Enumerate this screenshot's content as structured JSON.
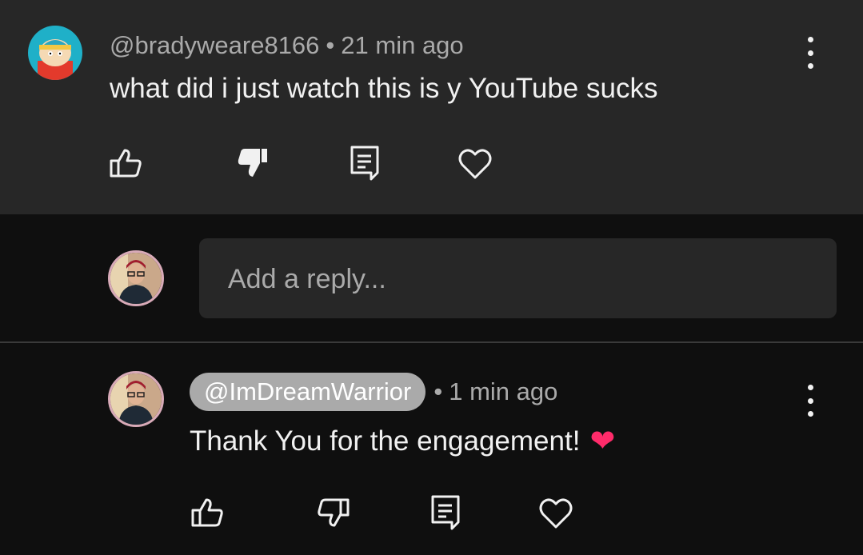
{
  "top_comment": {
    "author": "@bradyweare8166",
    "separator": "•",
    "time": "21 min ago",
    "text": "what did i just watch this is y YouTube sucks",
    "avatar_icon": "cartman-avatar-icon",
    "like_state": "none",
    "dislike_state": "active"
  },
  "reply_input": {
    "placeholder": "Add a reply..."
  },
  "reply_comment": {
    "author": "@ImDreamWarrior",
    "separator": "•",
    "time": "1 min ago",
    "text": "Thank You for the engagement!",
    "emoji": "❤"
  },
  "colors": {
    "background": "#0f0f0f",
    "card": "#272727",
    "secondary_text": "#aaaaaa",
    "primary_text": "#f1f1f1",
    "heart": "#ff2b6a"
  }
}
